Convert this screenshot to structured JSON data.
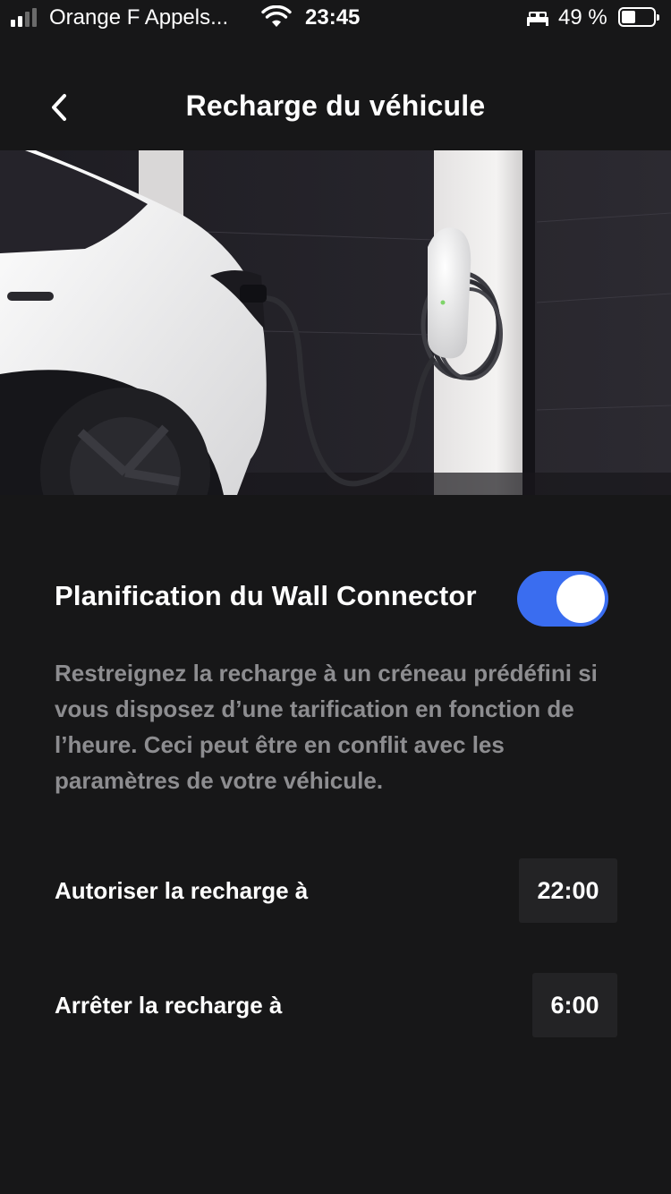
{
  "status_bar": {
    "carrier": "Orange F Appels...",
    "time": "23:45",
    "battery_percent": "49 %",
    "battery_level": 0.49,
    "icons": [
      "signal-icon",
      "wifi-icon",
      "bed-icon",
      "battery-icon"
    ]
  },
  "header": {
    "title": "Recharge du véhicule",
    "back_icon": "chevron-left-icon"
  },
  "hero": {
    "image": "white-car-charging-at-wall-connector"
  },
  "schedule": {
    "title": "Planification du Wall Connector",
    "enabled": true,
    "description": "Restreignez la recharge à un créneau prédéfini si vous disposez d’une tarification en fonction de l’heure. Ceci peut être en conflit avec les paramètres de votre véhicule.",
    "start_label": "Autoriser la recharge à",
    "start_time": "22:00",
    "stop_label": "Arrêter la recharge à",
    "stop_time": "6:00"
  },
  "colors": {
    "background": "#171718",
    "accent": "#3a6df0",
    "muted_text": "#8d8d90",
    "time_button": "#232325"
  }
}
